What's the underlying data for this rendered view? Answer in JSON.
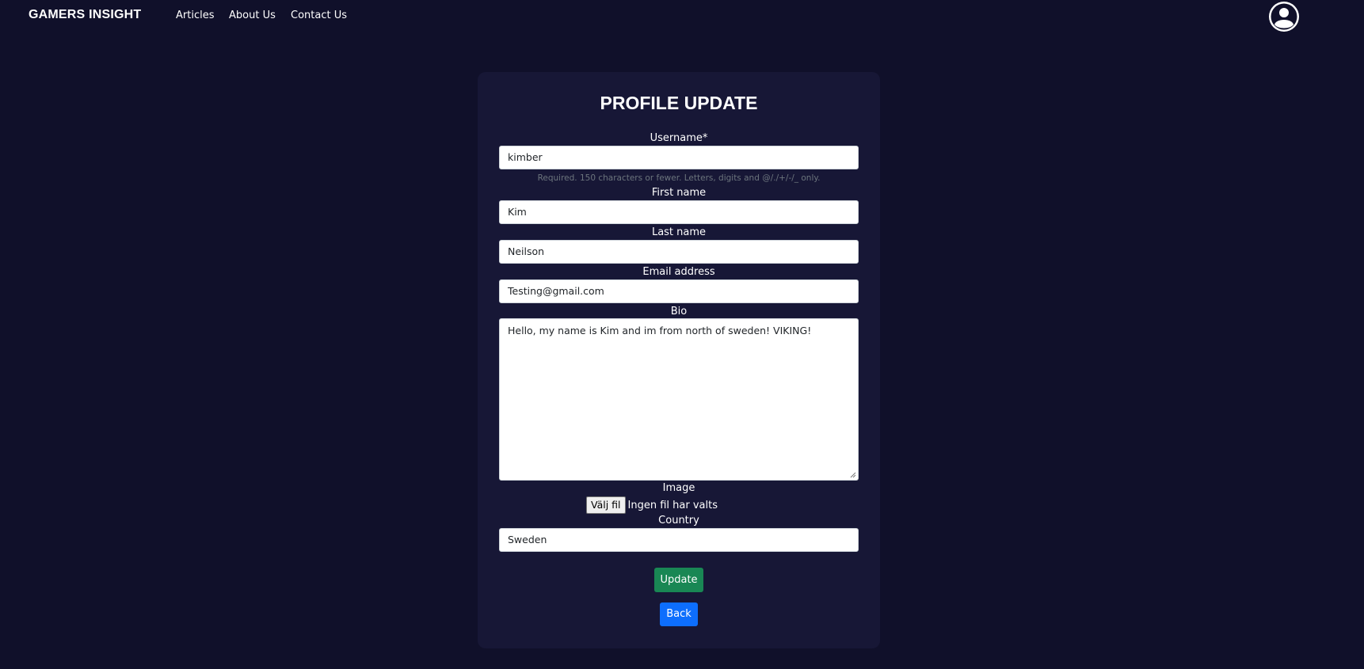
{
  "nav": {
    "brand": "GAMERS INSIGHT",
    "links": [
      "Articles",
      "About Us",
      "Contact Us"
    ],
    "avatar_icon": "user-circle-icon"
  },
  "form": {
    "title": "PROFILE UPDATE",
    "username": {
      "label": "Username*",
      "value": "kimber",
      "help": "Required. 150 characters or fewer. Letters, digits and @/./+/-/_ only."
    },
    "first_name": {
      "label": "First name",
      "value": "Kim"
    },
    "last_name": {
      "label": "Last name",
      "value": "Neilson"
    },
    "email": {
      "label": "Email address",
      "value": "Testing@gmail.com"
    },
    "bio": {
      "label": "Bio",
      "value": "Hello, my name is Kim and im from north of sweden! VIKING!"
    },
    "image": {
      "label": "Image",
      "button": "Välj fil",
      "status": "Ingen fil har valts"
    },
    "country": {
      "label": "Country",
      "value": "Sweden"
    },
    "update_button": "Update",
    "back_button": "Back"
  },
  "colors": {
    "page_bg": "#10102a",
    "card_bg": "#171736",
    "update": "#198754",
    "back": "#0d6efd"
  }
}
